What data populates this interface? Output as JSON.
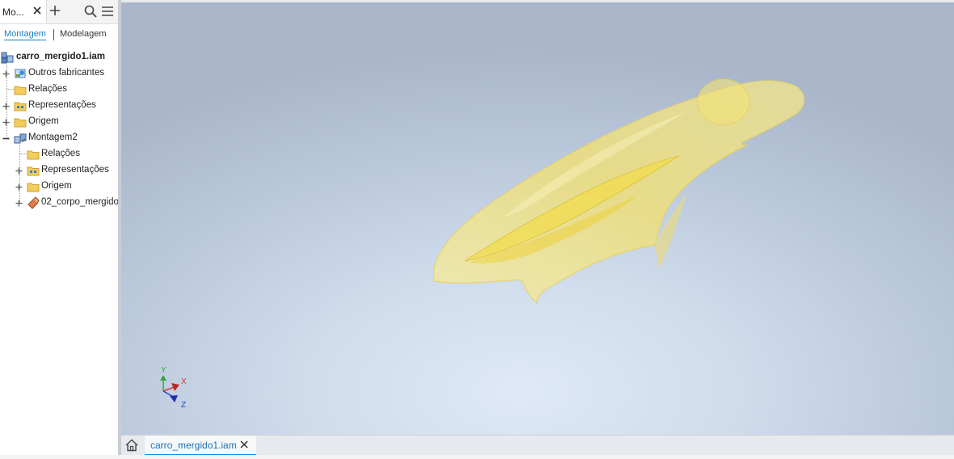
{
  "browser_panel": {
    "tab_label": "Mo...",
    "mode_tabs": {
      "active": "Montagem",
      "inactive": "Modelagem"
    }
  },
  "tree": {
    "root": "carro_mergido1.iam",
    "items": [
      {
        "label": "Outros fabricantes"
      },
      {
        "label": "Relações"
      },
      {
        "label": "Representações"
      },
      {
        "label": "Origem"
      },
      {
        "label": "Montagem2"
      },
      {
        "label": "Relações"
      },
      {
        "label": "Representações"
      },
      {
        "label": "Origem"
      },
      {
        "label": "02_corpo_mergido"
      }
    ]
  },
  "document_tabs": [
    {
      "label": "carro_mergido1.iam",
      "active": true
    }
  ],
  "axis_labels": {
    "x": "X",
    "y": "Y",
    "z": "Z"
  },
  "colors": {
    "accent": "#1a8fd8",
    "model_fill": "#f3e27a",
    "axis_x": "#d63a3a",
    "axis_y": "#2faa3a",
    "axis_z": "#2a3fd0",
    "folder": "#f2cd5c"
  },
  "icons": {
    "close": "close-icon",
    "add": "plus-icon",
    "search": "search-icon",
    "menu": "hamburger-menu-icon",
    "home": "home-icon"
  }
}
